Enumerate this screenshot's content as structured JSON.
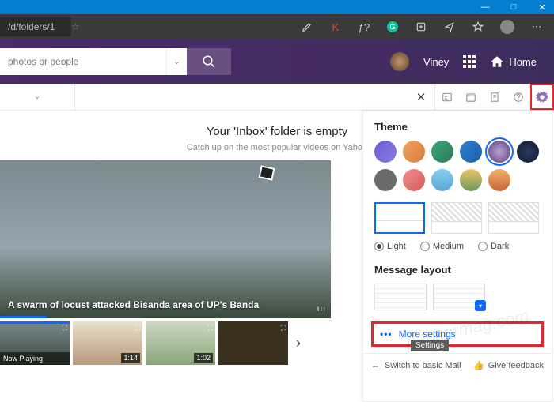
{
  "window": {
    "min": "—",
    "max": "□",
    "close": "✕"
  },
  "browser": {
    "url_fragment": "/d/folders/1",
    "star": "☆",
    "k": "K",
    "fx": "ƒ?"
  },
  "header": {
    "search_placeholder": "photos or people",
    "username": "Viney",
    "home_label": "Home"
  },
  "toolbar": {
    "close": "✕"
  },
  "empty": {
    "title": "Your 'Inbox' folder is empty",
    "subtitle": "Catch up on the most popular videos on Yahoo"
  },
  "video": {
    "caption": "A swarm of locust attacked Bisanda area of UP's Banda"
  },
  "thumbs": {
    "now_playing": "Now Playing",
    "d2": "1:14",
    "d3": "1:02"
  },
  "panel": {
    "theme_heading": "Theme",
    "light": "Light",
    "medium": "Medium",
    "dark": "Dark",
    "message_layout": "Message layout",
    "more_settings": "More settings",
    "dots": "•••"
  },
  "footer": {
    "tooltip": "Settings",
    "switch": "Switch to basic Mail",
    "feedback": "Give feedback"
  },
  "watermark": "geekermag.com"
}
